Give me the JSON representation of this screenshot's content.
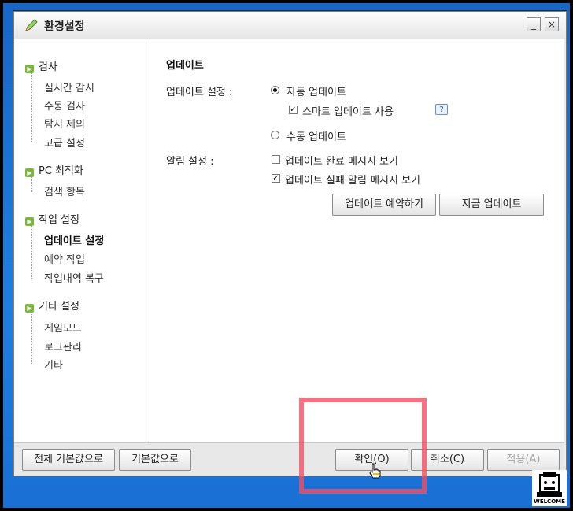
{
  "window": {
    "title": "환경설정",
    "minimize_label": "_",
    "close_label": "×"
  },
  "sidebar": {
    "categories": [
      {
        "label": "검사",
        "items": [
          "실시간 감시",
          "수동 검사",
          "탐지 제외",
          "고급 설정"
        ]
      },
      {
        "label": "PC 최적화",
        "items": [
          "검색 항목"
        ]
      },
      {
        "label": "작업 설정",
        "items": [
          "업데이트 설정",
          "예약 작업",
          "작업내역 복구"
        ]
      },
      {
        "label": "기타 설정",
        "items": [
          "게임모드",
          "로그관리",
          "기타"
        ]
      }
    ],
    "active_item": "업데이트 설정"
  },
  "content": {
    "section_title": "업데이트",
    "update_settings_label": "업데이트 설정 :",
    "auto_update_label": "자동 업데이트",
    "smart_update_label": "스마트 업데이트 사용",
    "help_label": "?",
    "manual_update_label": "수동 업데이트",
    "notification_label": "알림 설정 :",
    "complete_msg_label": "업데이트 완료 메시지 보기",
    "fail_msg_label": "업데이트 실패 알림 메시지 보기",
    "schedule_button": "업데이트 예약하기",
    "now_button": "지금 업데이트",
    "auto_update_selected": true,
    "smart_update_checked": true,
    "complete_msg_checked": false,
    "fail_msg_checked": true
  },
  "footer": {
    "reset_all_button": "전체 기본값으로",
    "reset_button": "기본값으로",
    "ok_button": "확인(O)",
    "cancel_button": "취소(C)",
    "apply_button": "적용(A)"
  },
  "badge": {
    "text": "WELCOME"
  },
  "colors": {
    "desktop": "#1a6fd4",
    "category_bullet": "#7ab83a",
    "highlight": "#f05064"
  }
}
